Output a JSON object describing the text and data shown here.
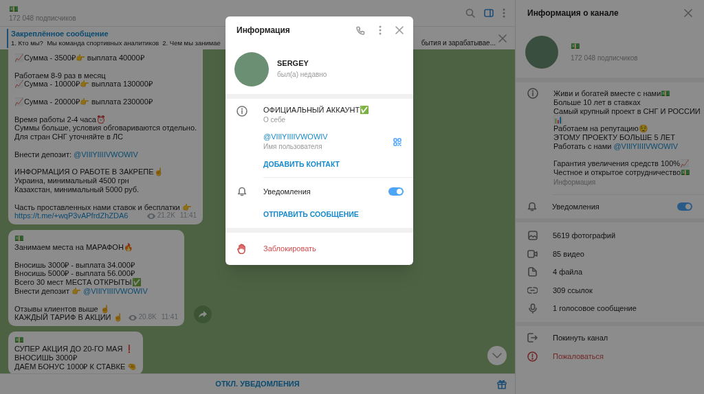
{
  "chat_header": {
    "title": "💵",
    "subtitle": "172 048 подписчиков"
  },
  "pinned": {
    "label": "Закреплённое сообщение",
    "text_start": "1. Кто мы?  Мы команда спортивных аналитиков  2. Чем мы занимае",
    "text_end": "бытия и зарабатывае..."
  },
  "messages": [
    {
      "paragraphs": [
        [
          "📈Сумма - 3500₽👉 выплата 40000₽"
        ],
        [
          "Работаем 8-9 раз в месяц",
          "📈Сумма - 10000₽👉 выплата 130000₽"
        ],
        [
          "📈Сумма - 20000₽👉 выплата 230000₽"
        ],
        [
          "Время работы 2-4 часа⏰",
          "Суммы больше, условия обговариваются отдельно.",
          "Для стран СНГ уточняйте в ЛС"
        ],
        [
          {
            "text": "Внести депозит: ",
            "link": "@VIIlYIIIIVWOWIV"
          }
        ],
        [
          "ИНФОРМАЦИЯ О РАБОТЕ В ЗАКРЕПЕ☝",
          "Украина, минимальный 4500 грн",
          "Казахстан, минимальный 5000 руб."
        ],
        [
          "Часть проставленных нами ставок и бесплатки 👉",
          {
            "link": "https://t.me/+wqP3vAPfrdZhZDA6"
          }
        ]
      ],
      "views": "21.2K",
      "time": "11:41",
      "forward_button": false
    },
    {
      "paragraphs": [
        [
          "💵",
          "Занимаем места на МАРАФОН🔥"
        ],
        [
          "Вносишь 3000₽ - выплата 34.000₽",
          "Вносишь 5000₽ - выплата 56.000₽",
          "Всего 30 мест МЕСТА ОТКРЫТЫ✅",
          {
            "text": "Внести депозит 👉 ",
            "link": "@VIIlYIIIIVWOWIV"
          }
        ],
        [
          "Отзывы клиентов выше ☝",
          "КАЖДЫЙ ТАРИФ В АКЦИИ ☝"
        ]
      ],
      "views": "20.8K",
      "time": "11:41",
      "forward_button": true
    },
    {
      "paragraphs": [
        [
          "💵",
          "СУПЕР АКЦИЯ ДО 20-ГО МАЯ ❗",
          "ВНОСИШЬ 3000₽",
          "ДАЁМ БОНУС 1000₽ К СТАВКЕ 🤏"
        ]
      ],
      "forward_button": false
    }
  ],
  "bottom_bar": {
    "button": "ОТКЛ. УВЕДОМЛЕНИЯ"
  },
  "modal": {
    "title": "Информация",
    "name": "SERGEY",
    "status": "был(а) недавно",
    "bio": "ОФИЦИАЛЬНЫЙ АККАУНТ✅",
    "bio_label": "О себе",
    "username": "@VIIlYIIIIVWOWIV",
    "username_label": "Имя пользователя",
    "add_contact": "ДОБАВИТЬ КОНТАКТ",
    "notifications": {
      "label": "Уведомления",
      "on": true
    },
    "send_message": "ОТПРАВИТЬ СООБЩЕНИЕ",
    "block": "Заблокировать"
  },
  "channel_info": {
    "title": "Информация о канале",
    "name": "💵",
    "subscribers": "172 048 подписчиков",
    "description": [
      [
        "Живи и богатей вместе с нами💵",
        "Больше 10 лет в ставках",
        "Самый крупный проект в СНГ И РОССИИ",
        "📊",
        "Работаем на репутацию😌",
        "ЭТОМУ ПРОЕКТУ БОЛЬШЕ 5 ЛЕТ",
        {
          "text": "Работать с нами ",
          "link": "@VIIlYIIIIVWOWIV"
        }
      ],
      [
        "Гарантия увеличения средств 100%📈",
        "Честное и открытое сотрудничество💵"
      ]
    ],
    "description_label": "Информация",
    "notifications": {
      "label": "Уведомления",
      "on": true
    },
    "media": [
      {
        "kind": "photo",
        "label": "5619 фотографий"
      },
      {
        "kind": "video",
        "label": "85 видео"
      },
      {
        "kind": "file",
        "label": "4 файла"
      },
      {
        "kind": "link",
        "label": "309 ссылок"
      },
      {
        "kind": "voice",
        "label": "1 голосовое сообщение"
      }
    ],
    "actions": [
      {
        "kind": "leave",
        "label": "Покинуть канал"
      },
      {
        "kind": "report",
        "label": "Пожаловаться"
      }
    ]
  }
}
